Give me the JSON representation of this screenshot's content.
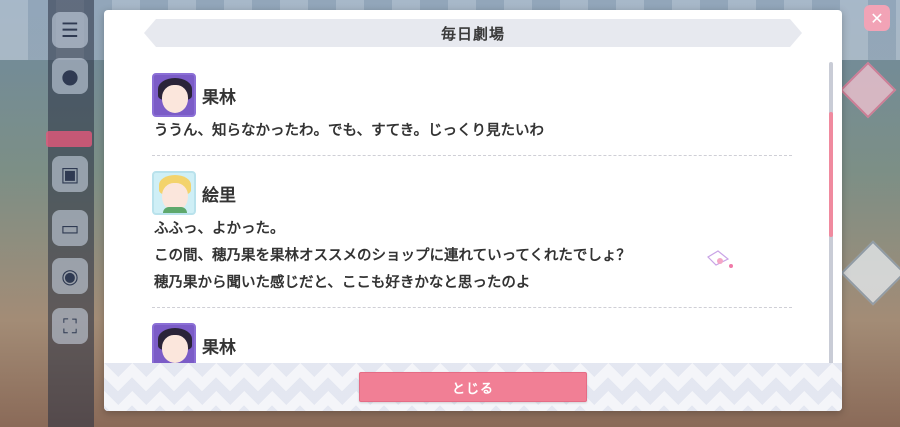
{
  "dialog": {
    "title": "毎日劇場",
    "close_label": "とじる"
  },
  "entries": [
    {
      "speaker": "果林",
      "avatar": "karin-avatar",
      "lines": [
        "ううん、知らなかったわ。でも、すてき。じっくり見たいわ"
      ]
    },
    {
      "speaker": "絵里",
      "avatar": "eli-avatar",
      "lines": [
        "ふふっ、よかった。",
        "この間、穂乃果を果林オススメのショップに連れていってくれたでしょ？",
        "穂乃果から聞いた感じだと、ここも好きかなと思ったのよ"
      ]
    },
    {
      "speaker": "果林",
      "avatar": "karin-avatar",
      "lines": []
    }
  ],
  "colors": {
    "accent": "#f17f95",
    "scroll_thumb": "#f08a9f",
    "header_bg": "#e7e9ef"
  },
  "scroll": {
    "position_fraction": 0.18
  }
}
